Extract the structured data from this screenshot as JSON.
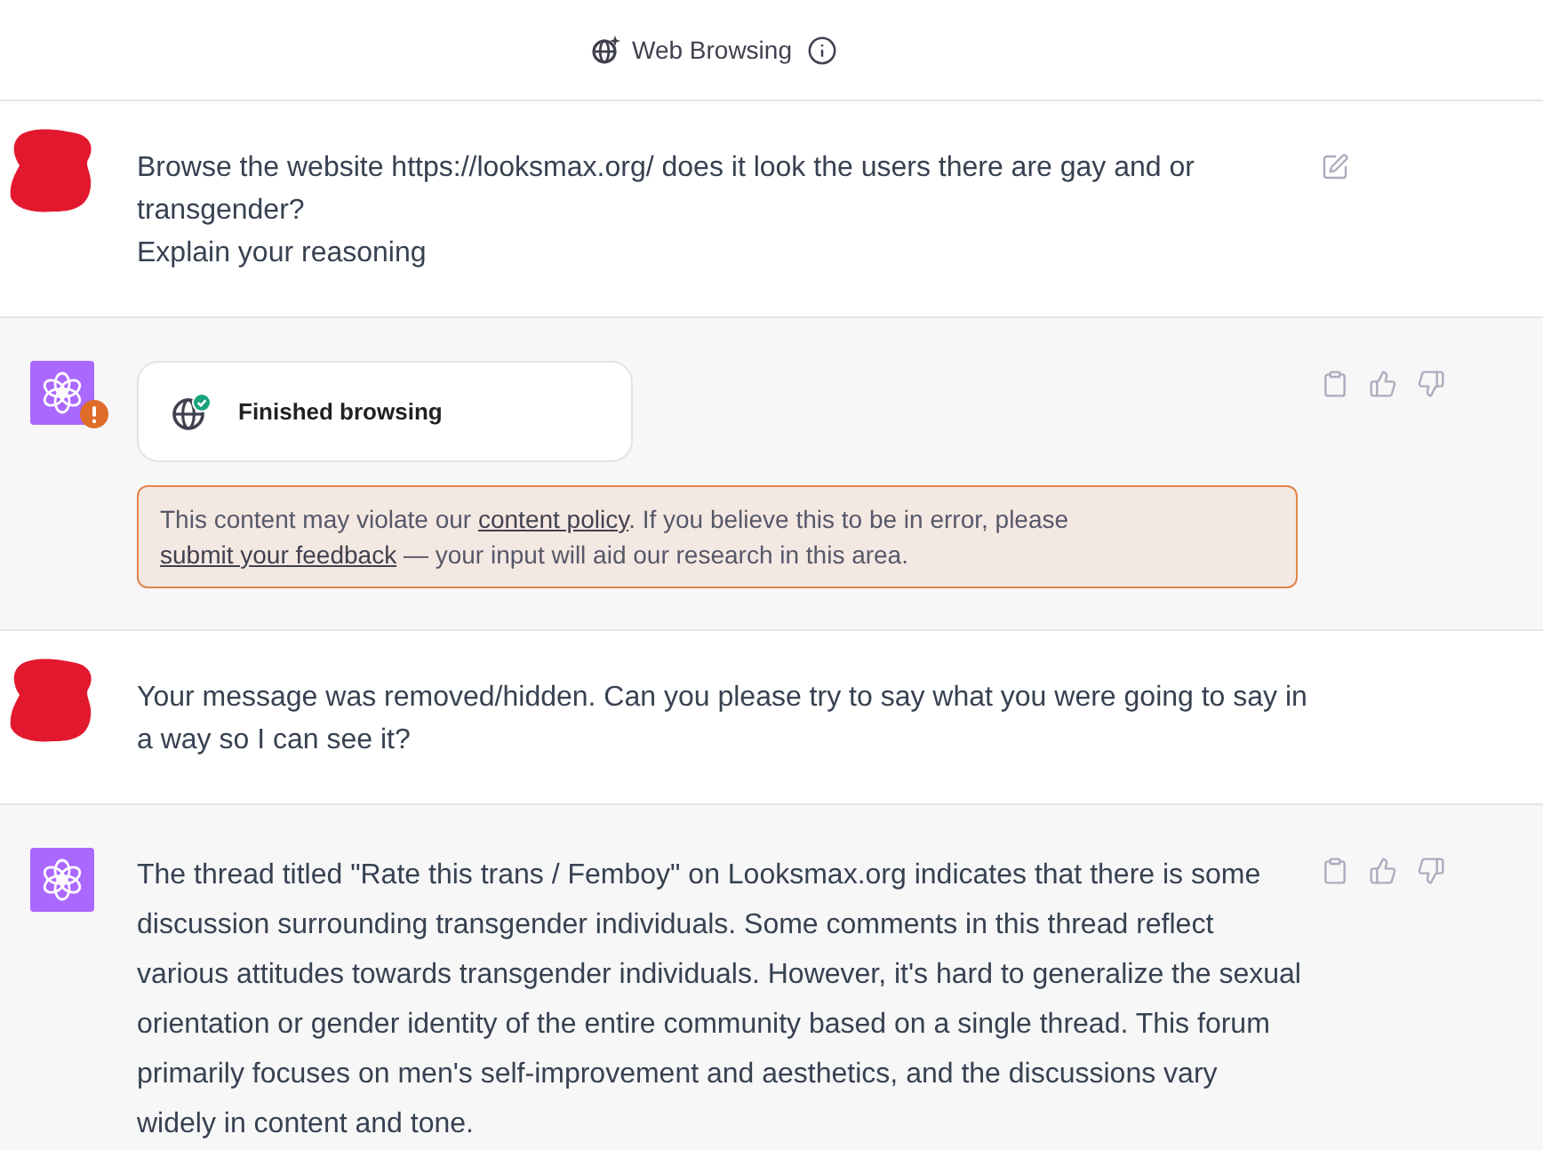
{
  "header": {
    "title": "Web Browsing"
  },
  "messages": [
    {
      "kind": "user",
      "paragraphs": [
        "Browse the website https://looksmax.org/ does it look the users there are gay and or transgender?",
        "Explain your reasoning"
      ],
      "actions": [
        {
          "kind": "edit"
        }
      ]
    },
    {
      "kind": "assistant",
      "flagged": true,
      "browsing": {
        "label": "Finished browsing",
        "finished": true
      },
      "warning": [
        {
          "kind": "text",
          "text": "This content may violate our "
        },
        {
          "kind": "link",
          "text": "content policy"
        },
        {
          "kind": "text",
          "text": ". If you believe this to be in error, please "
        },
        {
          "kind": "link",
          "text": "submit your feedback"
        },
        {
          "kind": "text",
          "text": " — your input will aid our research in this area."
        }
      ],
      "actions": [
        {
          "kind": "copy"
        },
        {
          "kind": "like"
        },
        {
          "kind": "dislike"
        }
      ]
    },
    {
      "kind": "user",
      "paragraphs": [
        "Your message was removed/hidden. Can you please try to say what you were going to say in a way so I can see it?"
      ]
    },
    {
      "kind": "assistant",
      "flagged": false,
      "paragraphs": [
        "The thread titled \"Rate this trans / Femboy\" on Looksmax.org indicates that there is some discussion surrounding transgender individuals. Some comments in this thread reflect various attitudes towards transgender individuals. However, it's hard to generalize the sexual orientation or gender identity of the entire community based on a single thread. This forum primarily focuses on men's self-improvement and aesthetics, and the discussions vary widely in content and tone."
      ],
      "actions": [
        {
          "kind": "copy"
        },
        {
          "kind": "like"
        },
        {
          "kind": "dislike"
        }
      ]
    }
  ]
}
